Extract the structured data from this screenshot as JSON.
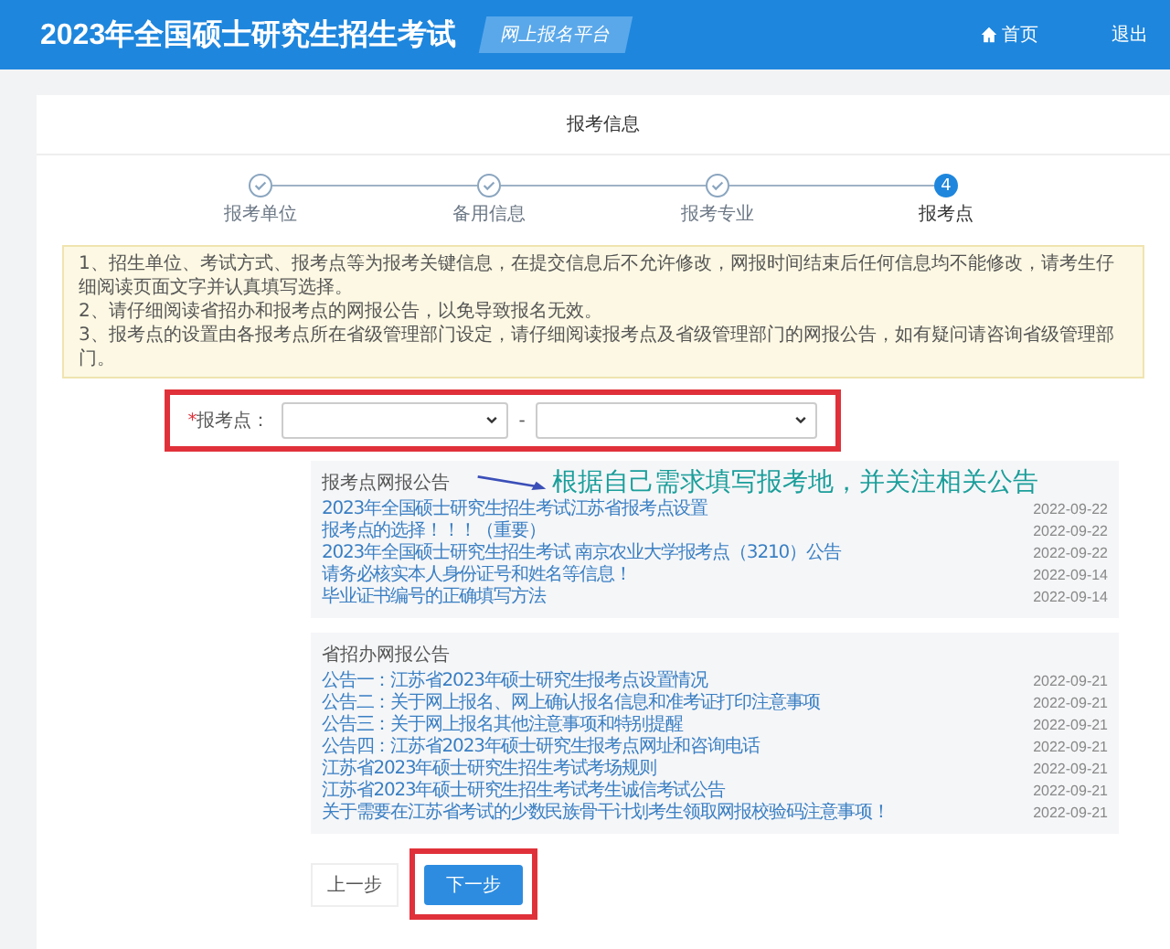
{
  "header": {
    "title": "2023年全国硕士研究生招生考试",
    "badge": "网上报名平台",
    "links": [
      {
        "kind": "home",
        "label": "首页"
      },
      {
        "kind": "plain",
        "label": "退出"
      }
    ]
  },
  "card_title": "报考信息",
  "steps": [
    {
      "label": "报考单位",
      "done": true
    },
    {
      "label": "备用信息",
      "done": true
    },
    {
      "label": "报考专业",
      "done": true
    },
    {
      "label": "报考点",
      "done": false,
      "number": "4"
    }
  ],
  "notices": [
    "1、招生单位、考试方式、报考点等为报考关键信息，在提交信息后不允许修改，网报时间结束后任何信息均不能修改，请考生仔细阅读页面文字并认真填写选择。",
    "2、请仔细阅读省招办和报考点的网报公告，以免导致报名无效。",
    "3、报考点的设置由各报考点所在省级管理部门设定，请仔细阅读报考点及省级管理部门的网报公告，如有疑问请咨询省级管理部门。"
  ],
  "site_field": {
    "required_mark": "*",
    "label": "报考点：",
    "separator": "-"
  },
  "annotation": "根据自己需求填写报考地，并关注相关公告",
  "bulletins": [
    {
      "title": "报考点网报公告",
      "items": [
        {
          "text": "2023年全国硕士研究生招生考试江苏省报考点设置",
          "date": "2022-09-22"
        },
        {
          "text": "报考点的选择！！！（重要）",
          "date": "2022-09-22"
        },
        {
          "text": "2023年全国硕士研究生招生考试 南京农业大学报考点（3210）公告",
          "date": "2022-09-22"
        },
        {
          "text": "请务必核实本人身份证号和姓名等信息！",
          "date": "2022-09-14"
        },
        {
          "text": "毕业证书编号的正确填写方法",
          "date": "2022-09-14"
        }
      ]
    },
    {
      "title": "省招办网报公告",
      "items": [
        {
          "text": "公告一：江苏省2023年硕士研究生报考点设置情况",
          "date": "2022-09-21"
        },
        {
          "text": "公告二：关于网上报名、网上确认报名信息和准考证打印注意事项",
          "date": "2022-09-21"
        },
        {
          "text": "公告三：关于网上报名其他注意事项和特别提醒",
          "date": "2022-09-21"
        },
        {
          "text": "公告四：江苏省2023年硕士研究生报考点网址和咨询电话",
          "date": "2022-09-21"
        },
        {
          "text": "江苏省2023年硕士研究生招生考试考场规则",
          "date": "2022-09-21"
        },
        {
          "text": "江苏省2023年硕士研究生招生考试考生诚信考试公告",
          "date": "2022-09-21"
        },
        {
          "text": "关于需要在江苏省考试的少数民族骨干计划考生领取网报校验码注意事项！",
          "date": "2022-09-21"
        }
      ]
    }
  ],
  "buttons": [
    {
      "kind": "secondary",
      "label": "上一步"
    },
    {
      "kind": "primary",
      "label": "下一步"
    }
  ]
}
